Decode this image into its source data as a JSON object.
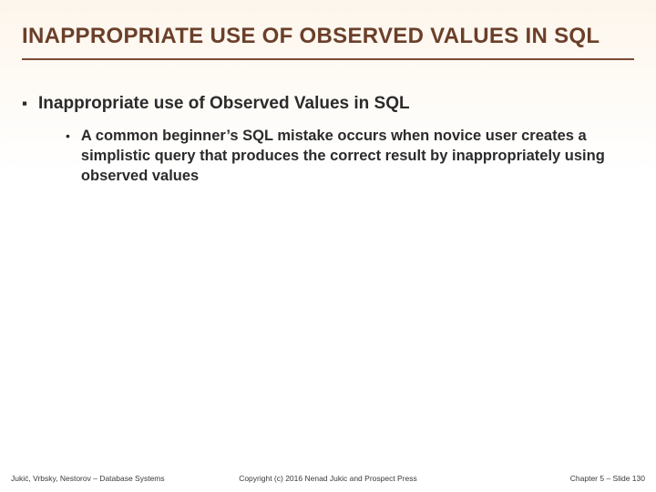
{
  "title": "INAPPROPRIATE USE OF OBSERVED VALUES IN SQL",
  "bullets": {
    "level1_marker": "▪",
    "level1_text": "Inappropriate use of Observed Values in SQL",
    "level2_marker": "•",
    "level2_text": "A common beginner’s SQL mistake occurs when novice user creates a simplistic query that produces the correct result by inappropriately using observed values"
  },
  "footer": {
    "left": "Jukić, Vrbsky, Nestorov – Database Systems",
    "center": "Copyright (c) 2016 Nenad Jukic and Prospect Press",
    "right": "Chapter 5 – Slide 130"
  }
}
